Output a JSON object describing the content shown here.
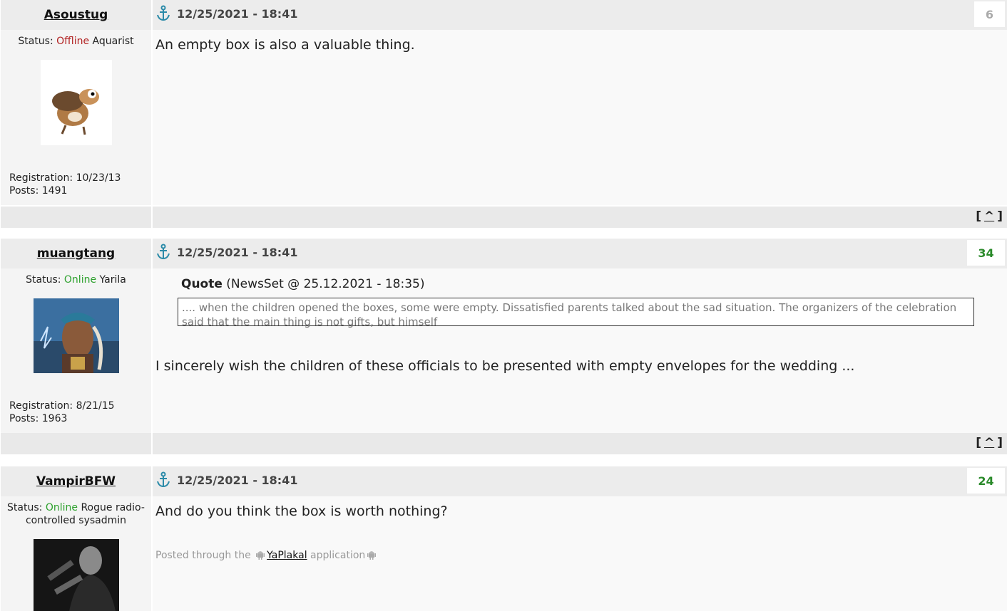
{
  "posts": [
    {
      "author": "Asoustug",
      "date": "12/25/2021 - 18:41",
      "rating": "6",
      "status_label": "Status:",
      "status": "Offline",
      "rank": "Aquarist",
      "registration": "Registration: 10/23/13",
      "posts_count": "Posts: 1491",
      "avatar": "squirrel-avatar",
      "text": "An empty box is also a valuable thing."
    },
    {
      "author": "muangtang",
      "date": "12/25/2021 - 18:41",
      "rating": "34",
      "status_label": "Status:",
      "status": "Online",
      "rank": "Yarila",
      "registration": "Registration: 8/21/15",
      "posts_count": "Posts: 1963",
      "avatar": "warrior-avatar",
      "quote_label": "Quote",
      "quote_source": "(NewsSet @ 25.12.2021 - 18:35)",
      "quote_text": ".... when the children opened the boxes, some were empty. Dissatisfied parents talked about the sad situation. The organizers of the celebration said that the main thing is not gifts, but himself",
      "text": "I sincerely wish the children of these officials to be presented with empty envelopes for the wedding ..."
    },
    {
      "author": "VampirBFW",
      "date": "12/25/2021 - 18:41",
      "rating": "24",
      "status_label": "Status:",
      "status": "Online",
      "rank": "Rogue radio-controlled sysadmin",
      "avatar": "hitman-avatar",
      "text": "And do you think the box is worth nothing?",
      "via_prefix": "Posted through the",
      "via_app": "YaPlakal",
      "via_suffix": "application"
    }
  ],
  "footer_link": "^",
  "icons": [
    "anchor-icon",
    "android-icon"
  ],
  "colors": {
    "offline": "#b22222",
    "online": "#2ea12e",
    "rating": "#2a8a2a",
    "anchor": "#2a8aa8"
  }
}
